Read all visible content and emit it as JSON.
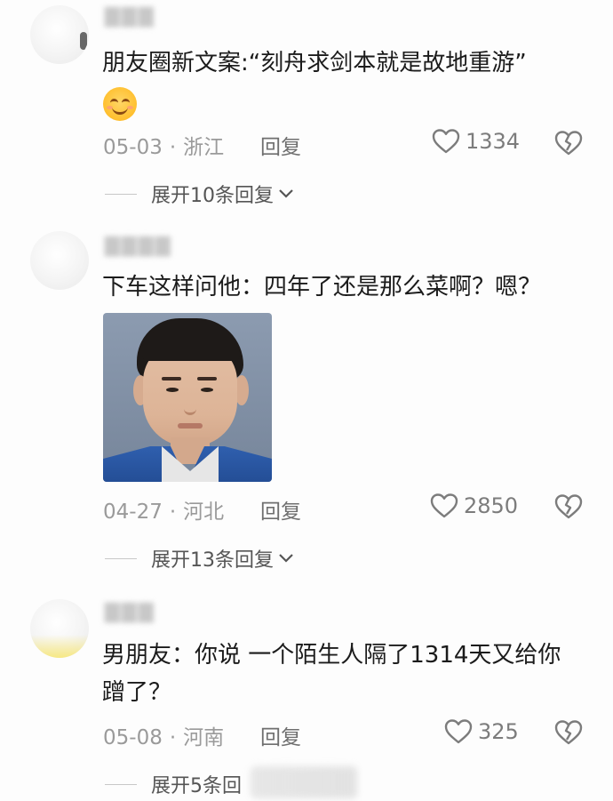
{
  "comments": [
    {
      "text": "朋友圈新文案:“刻舟求剑本就是故地重游”",
      "date": "05-03",
      "location": "浙江",
      "reply_label": "回复",
      "likes": "1334",
      "expand_label": "展开10条回复"
    },
    {
      "text": "下车这样问他：四年了还是那么菜啊？嗯？",
      "date": "04-27",
      "location": "河北",
      "reply_label": "回复",
      "likes": "2850",
      "expand_label": "展开13条回复"
    },
    {
      "text": "男朋友：你说 一个陌生人隔了1314天又给你蹭了？",
      "date": "05-08",
      "location": "河南",
      "reply_label": "回复",
      "likes": "325",
      "expand_label": "展开5条回"
    }
  ],
  "separator": "·",
  "icons": {
    "like": "heart-outline-icon",
    "dislike": "broken-heart-icon",
    "expand": "chevron-down-icon",
    "emoji": "smiling-face-emoji"
  },
  "colors": {
    "text": "#1b1b1b",
    "meta": "#9a9a9a",
    "icon": "#7c7c7c"
  }
}
